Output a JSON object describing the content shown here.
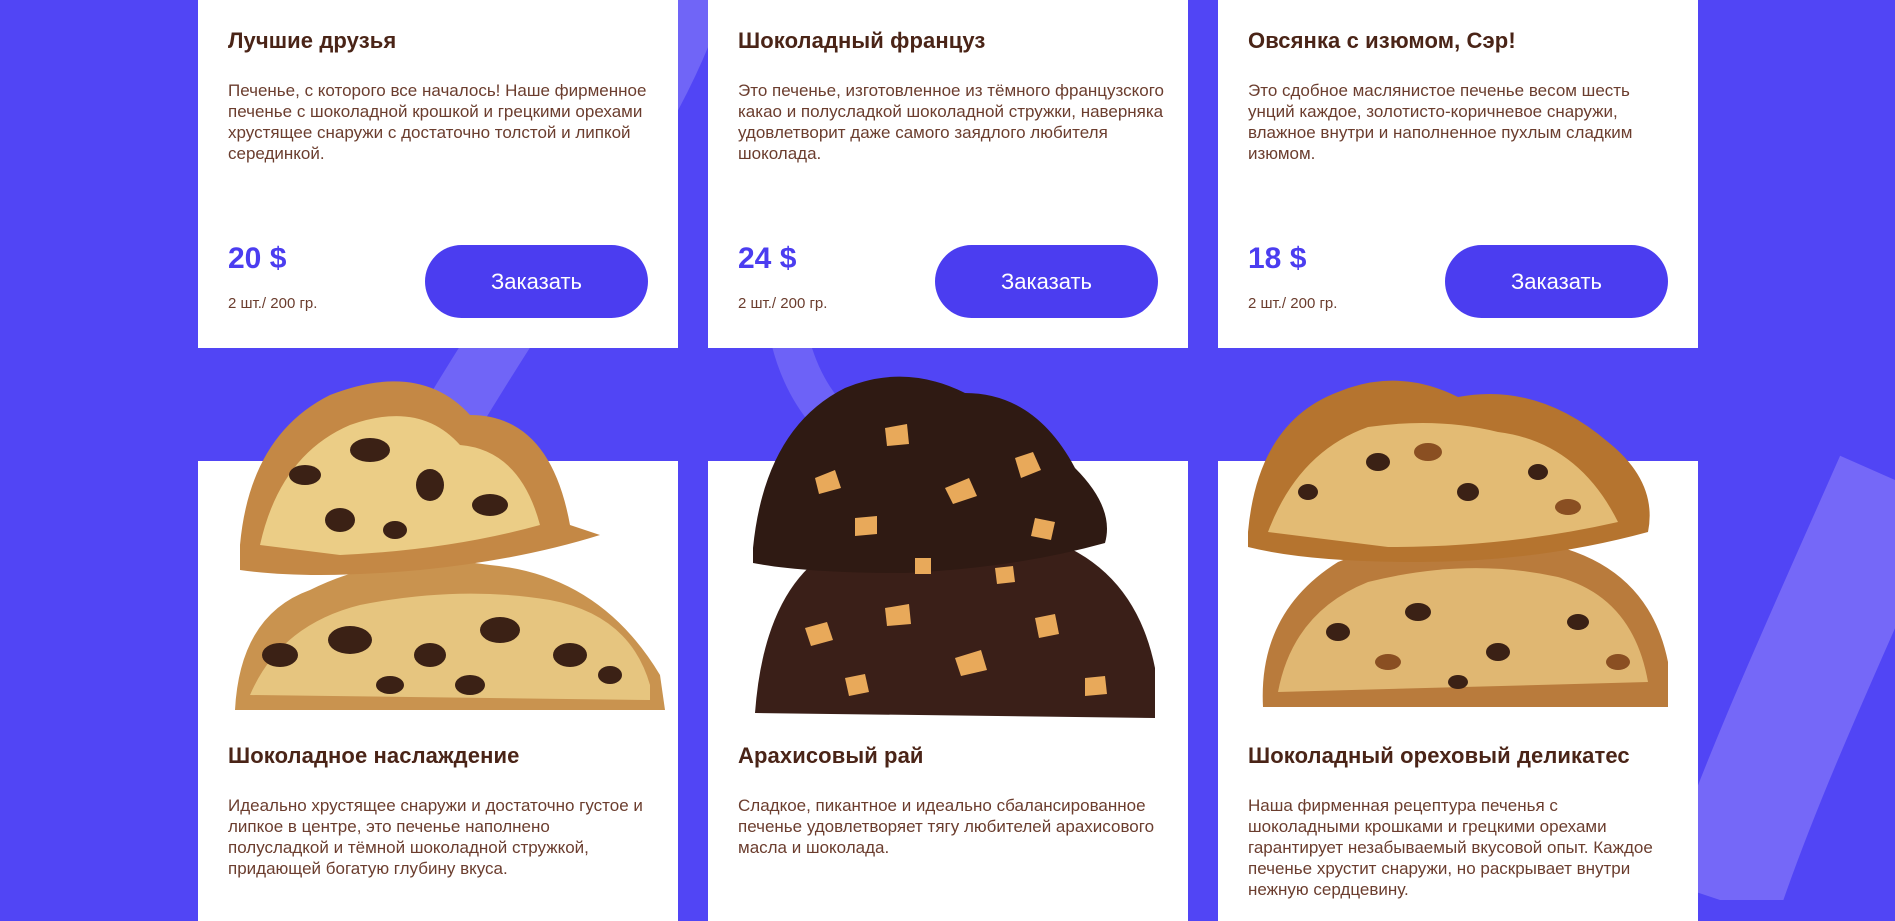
{
  "products_top": [
    {
      "name": "Лучшие друзья",
      "description": "Печенье, с которого все началось! Наше фирменное печенье с шоколадной крошкой и грецкими орехами хрустящее снаружи с достаточно толстой и липкой серединкой.",
      "price": "20 $",
      "weight": "2 шт./ 200 гр.",
      "order_label": "Заказать"
    },
    {
      "name": "Шоколадный француз",
      "description": "Это печенье, изготовленное из тёмного французского какао и полусладкой шоколадной стружки, наверняка удовлетворит даже самого заядлого любителя шоколада.",
      "price": "24 $",
      "weight": "2 шт./ 200 гр.",
      "order_label": "Заказать"
    },
    {
      "name": "Овсянка с изюмом, Сэр!",
      "description": "Это сдобное маслянистое печенье весом шесть унций каждое, золотисто-коричневое снаружи, влажное внутри и наполненное пухлым сладким изюмом.",
      "price": "18 $",
      "weight": "2 шт./ 200 гр.",
      "order_label": "Заказать"
    }
  ],
  "products_bottom": [
    {
      "name": "Шоколадное наслаждение",
      "description": "Идеально хрустящее снаружи и достаточно густое и липкое в центре, это печенье наполнено полусладкой и тёмной шоколадной стружкой, придающей богатую глубину вкуса.",
      "image_icon": "chocolate-chip-cookie-image"
    },
    {
      "name": "Арахисовый рай",
      "description": "Сладкое, пикантное и идеально сбалансированное печенье удовлетворяет тягу любителей арахисового масла и шоколада.",
      "image_icon": "peanut-butter-chocolate-cookie-image"
    },
    {
      "name": "Шоколадный ореховый деликатес",
      "description": "Наша фирменная рецептура печенья с шоколадными крошками и грецкими орехами гарантирует незабываемый вкусовой опыт. Каждое печенье хрустит снаружи, но раскрывает внутри нежную сердцевину.",
      "image_icon": "walnut-chocolate-cookie-image"
    }
  ],
  "colors": {
    "background": "#5145f5",
    "accent": "#4b3df0",
    "title_text": "#4a2417",
    "body_text": "#6b3d2e",
    "card": "#ffffff"
  }
}
